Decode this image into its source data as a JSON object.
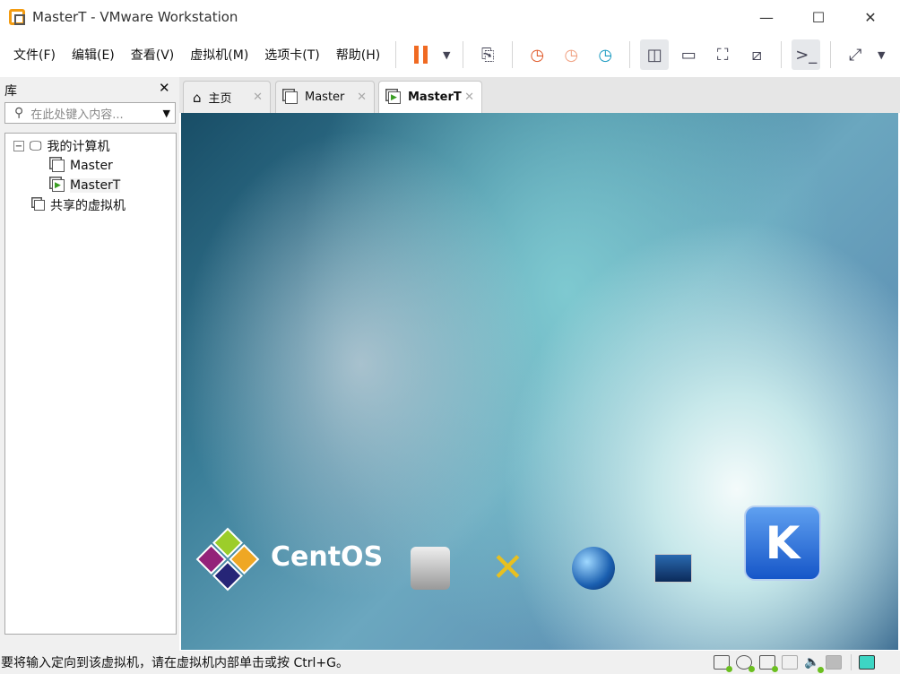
{
  "window": {
    "title": "MasterT - VMware Workstation"
  },
  "menubar": {
    "items": [
      "文件(F)",
      "编辑(E)",
      "查看(V)",
      "虚拟机(M)",
      "选项卡(T)",
      "帮助(H)"
    ]
  },
  "library": {
    "title": "库",
    "search_placeholder": "在此处键入内容...",
    "tree": {
      "root": "我的计算机",
      "vms": [
        "Master",
        "MasterT"
      ],
      "shared": "共享的虚拟机"
    }
  },
  "tabs": [
    {
      "label": "主页",
      "icon": "home-icon"
    },
    {
      "label": "Master",
      "icon": "vm-icon"
    },
    {
      "label": "MasterT",
      "icon": "vm-running-icon",
      "active": true
    }
  ],
  "guest": {
    "brand": "CentOS"
  },
  "status": {
    "message": "要将输入定向到该虚拟机，请在虚拟机内部单击或按 Ctrl+G。"
  },
  "colors": {
    "pause": "#f06a22",
    "device_active": "#6bbf1f",
    "note": "#3dd6c4"
  }
}
